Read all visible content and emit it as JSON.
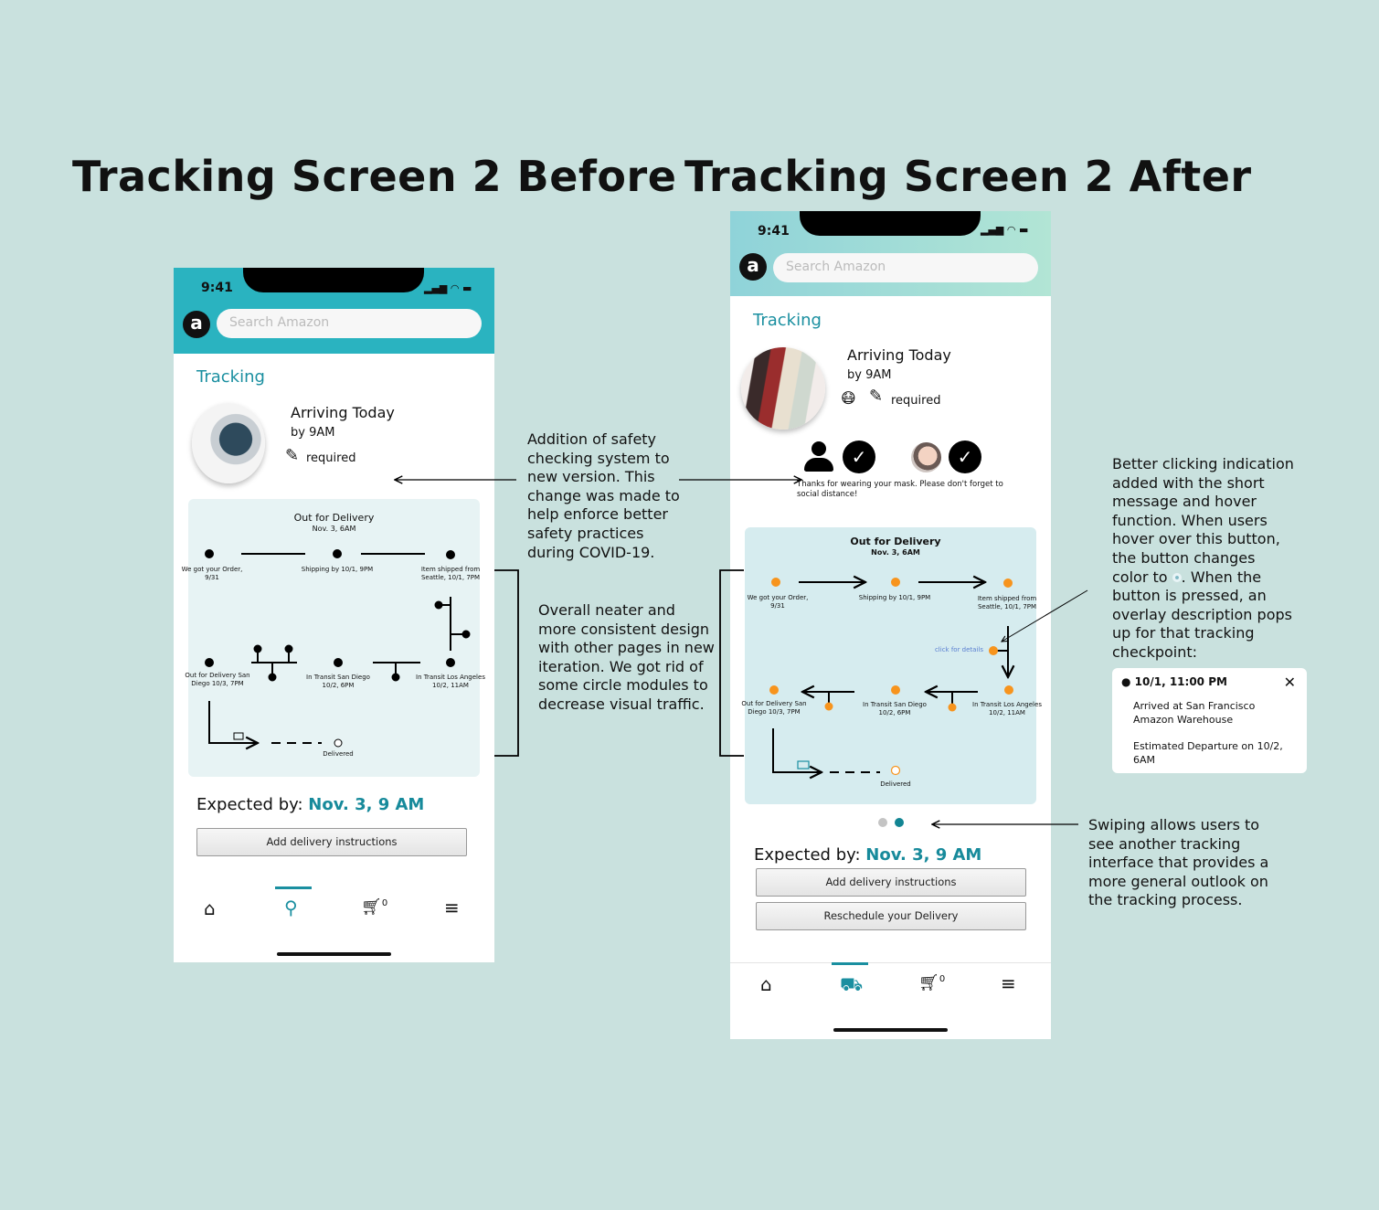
{
  "titles": {
    "before": "Tracking Screen 2 Before",
    "after": "Tracking Screen 2 After"
  },
  "colors": {
    "background": "#c9e1de",
    "before_header": "#2ab3c0",
    "after_header_start": "#8fd3d9",
    "after_header_end": "#b2e5d5",
    "accent": "#1a8fa0",
    "checkpoint": "#f7941d",
    "link": "#5a7fd1"
  },
  "before": {
    "status_time": "9:41",
    "search_placeholder": "Search Amazon",
    "logo": "a",
    "section": "Tracking",
    "arriving": "Arriving Today",
    "by": "by 9AM",
    "required": "required",
    "timeline": {
      "title": "Out for Delivery",
      "subtitle": "Nov. 3, 6AM",
      "steps": [
        "We got your Order, 9/31",
        "Shipping by 10/1, 9PM",
        "Item shipped from Seattle, 10/1, 7PM",
        "Out for Delivery San Diego 10/3, 7PM",
        "In Transit San Diego 10/2, 6PM",
        "In Transit Los Angeles 10/2, 11AM",
        "Delivered"
      ]
    },
    "expected_label": "Expected by: ",
    "expected_value": "Nov. 3, 9 AM",
    "buttons": [
      "Add delivery instructions"
    ],
    "nav": [
      "home-icon",
      "account-icon",
      "cart-icon",
      "menu-icon"
    ],
    "cart_count": "0",
    "active_nav": "account"
  },
  "after": {
    "status_time": "9:41",
    "search_placeholder": "Search Amazon",
    "logo": "a",
    "section": "Tracking",
    "arriving": "Arriving Today",
    "by": "by 9AM",
    "required": "required",
    "safety_message": "Thanks for wearing your mask. Please don't forget to social distance!",
    "timeline": {
      "title": "Out for Delivery",
      "subtitle": "Nov. 3, 6AM",
      "click_details": "click for details",
      "steps": [
        "We got your Order, 9/31",
        "Shipping by 10/1, 9PM",
        "Item shipped from Seattle, 10/1, 7PM",
        "Out for Delivery San Diego 10/3, 7PM",
        "In Transit San Diego 10/2, 6PM",
        "In Transit Los Angeles 10/2, 11AM",
        "Delivered"
      ]
    },
    "page_indicator": {
      "pages": 2,
      "current": 2
    },
    "expected_label": "Expected by: ",
    "expected_value": "Nov. 3, 9 AM",
    "buttons": [
      "Add delivery instructions",
      "Reschedule your Delivery"
    ],
    "nav": [
      "home-icon",
      "truck-icon",
      "cart-icon",
      "menu-icon"
    ],
    "cart_count": "0",
    "active_nav": "tracking"
  },
  "popup": {
    "time": "10/1, 11:00 PM",
    "line1": "Arrived at San Francisco Amazon Warehouse",
    "line2": "Estimated Departure on 10/2, 6AM"
  },
  "notes": {
    "safety": "Addition of safety checking system to new version. This change was made to help enforce better safety practices during COVID-19.",
    "design": "Overall neater and more consistent design with other pages in new iteration. We got rid of some circle modules to decrease visual traffic.",
    "clicking_a": "Better clicking indication added with the short message and hover function. When users hover over this button, the button changes color to",
    "clicking_b": "When the button is pressed, an overlay description pops up for that tracking checkpoint:",
    "swiping": "Swiping allows users to see another tracking interface that provides a more general outlook on the tracking process."
  }
}
